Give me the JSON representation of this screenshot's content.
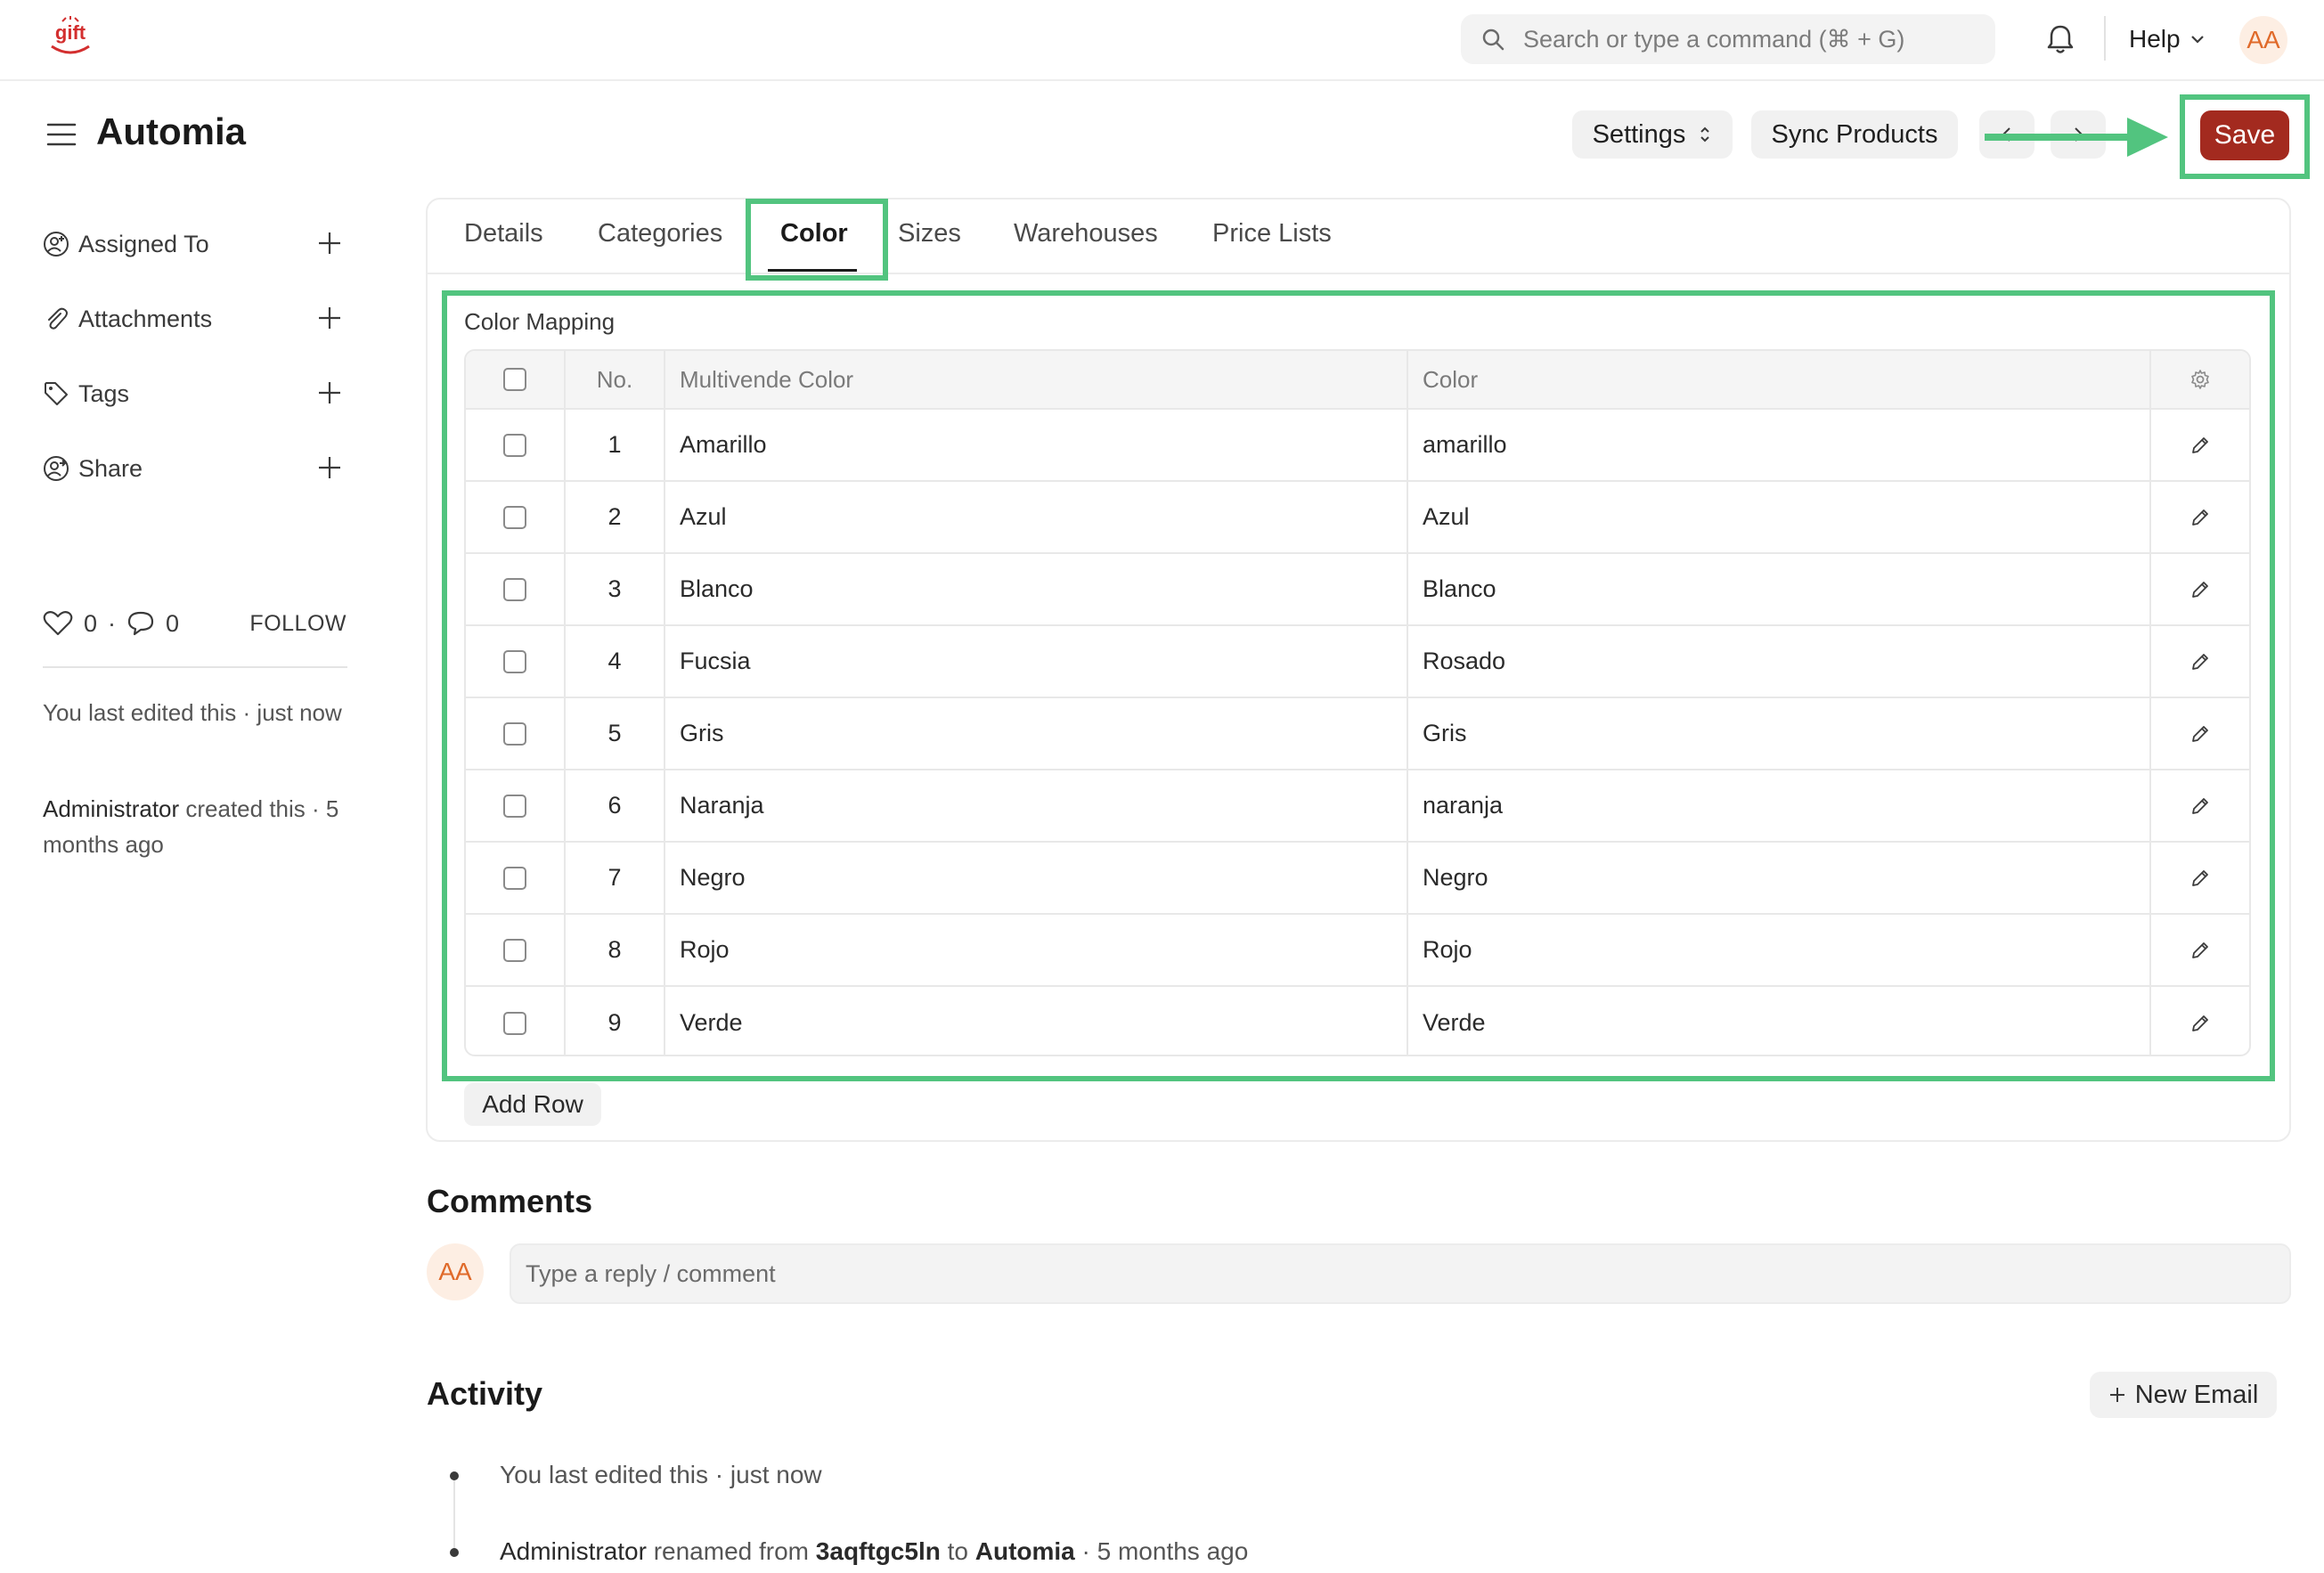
{
  "navbar": {
    "search_placeholder": "Search or type a command (⌘ + G)",
    "help_label": "Help",
    "user_initials": "AA"
  },
  "header": {
    "title": "Automia",
    "settings_label": "Settings",
    "sync_label": "Sync Products",
    "save_label": "Save"
  },
  "sidebar": {
    "items": [
      {
        "label": "Assigned To",
        "icon": "user-add-icon"
      },
      {
        "label": "Attachments",
        "icon": "paperclip-icon"
      },
      {
        "label": "Tags",
        "icon": "tag-icon"
      },
      {
        "label": "Share",
        "icon": "share-user-icon"
      }
    ],
    "likes_count": "0",
    "comments_count": "0",
    "follow_label": "FOLLOW",
    "last_edit_prefix": "You last edited this · just now",
    "created_by": "Administrator",
    "created_suffix": " created this · 5 months ago"
  },
  "tabs": [
    "Details",
    "Categories",
    "Color",
    "Sizes",
    "Warehouses",
    "Price Lists"
  ],
  "active_tab": "Color",
  "color_mapping": {
    "label": "Color Mapping",
    "columns": {
      "no": "No.",
      "multivende": "Multivende Color",
      "color": "Color"
    },
    "rows": [
      {
        "no": "1",
        "multivende": "Amarillo",
        "color": "amarillo"
      },
      {
        "no": "2",
        "multivende": "Azul",
        "color": "Azul"
      },
      {
        "no": "3",
        "multivende": "Blanco",
        "color": "Blanco"
      },
      {
        "no": "4",
        "multivende": "Fucsia",
        "color": "Rosado"
      },
      {
        "no": "5",
        "multivende": "Gris",
        "color": "Gris"
      },
      {
        "no": "6",
        "multivende": "Naranja",
        "color": "naranja"
      },
      {
        "no": "7",
        "multivende": "Negro",
        "color": "Negro"
      },
      {
        "no": "8",
        "multivende": "Rojo",
        "color": "Rojo"
      },
      {
        "no": "9",
        "multivende": "Verde",
        "color": "Verde"
      }
    ],
    "add_row_label": "Add Row"
  },
  "comments": {
    "title": "Comments",
    "avatar_initials": "AA",
    "placeholder": "Type a reply / comment"
  },
  "activity": {
    "title": "Activity",
    "new_email_label": "New Email",
    "item1": "You last edited this · just now",
    "item2": {
      "actor": "Administrator",
      "text1": " renamed from ",
      "from": "3aqftgc5ln",
      "text2": " to ",
      "to": "Automia",
      "text3": " · 5 months ago"
    }
  },
  "colors": {
    "save_button": "#a32a1f",
    "highlight": "#52c47f",
    "avatar_bg": "#fdeee3",
    "avatar_text": "#e06a2a"
  }
}
